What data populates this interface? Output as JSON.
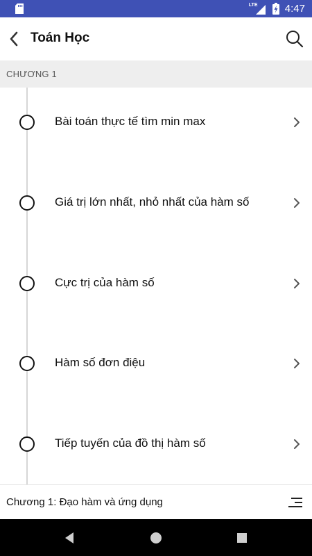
{
  "status_bar": {
    "network": "LTE",
    "time": "4:47",
    "bg_color": "#3f51b5"
  },
  "app_bar": {
    "title": "Toán Học",
    "back_icon": "back-arrow-icon",
    "search_icon": "search-icon"
  },
  "section": {
    "header": "CHƯƠNG 1"
  },
  "lessons": [
    {
      "label": "Bài toán thực tế tìm min max"
    },
    {
      "label": "Giá trị lớn nhất, nhỏ nhất của hàm số"
    },
    {
      "label": "Cực trị của hàm số"
    },
    {
      "label": "Hàm số đơn điệu"
    },
    {
      "label": "Tiếp tuyến của đồ thị hàm số"
    }
  ],
  "chapter_bar": {
    "label": "Chương 1: Đạo hàm và ứng dụng",
    "menu_icon": "list-menu-icon"
  },
  "nav_bar": {
    "back_icon": "nav-back-icon",
    "home_icon": "nav-home-icon",
    "recents_icon": "nav-recents-icon"
  }
}
